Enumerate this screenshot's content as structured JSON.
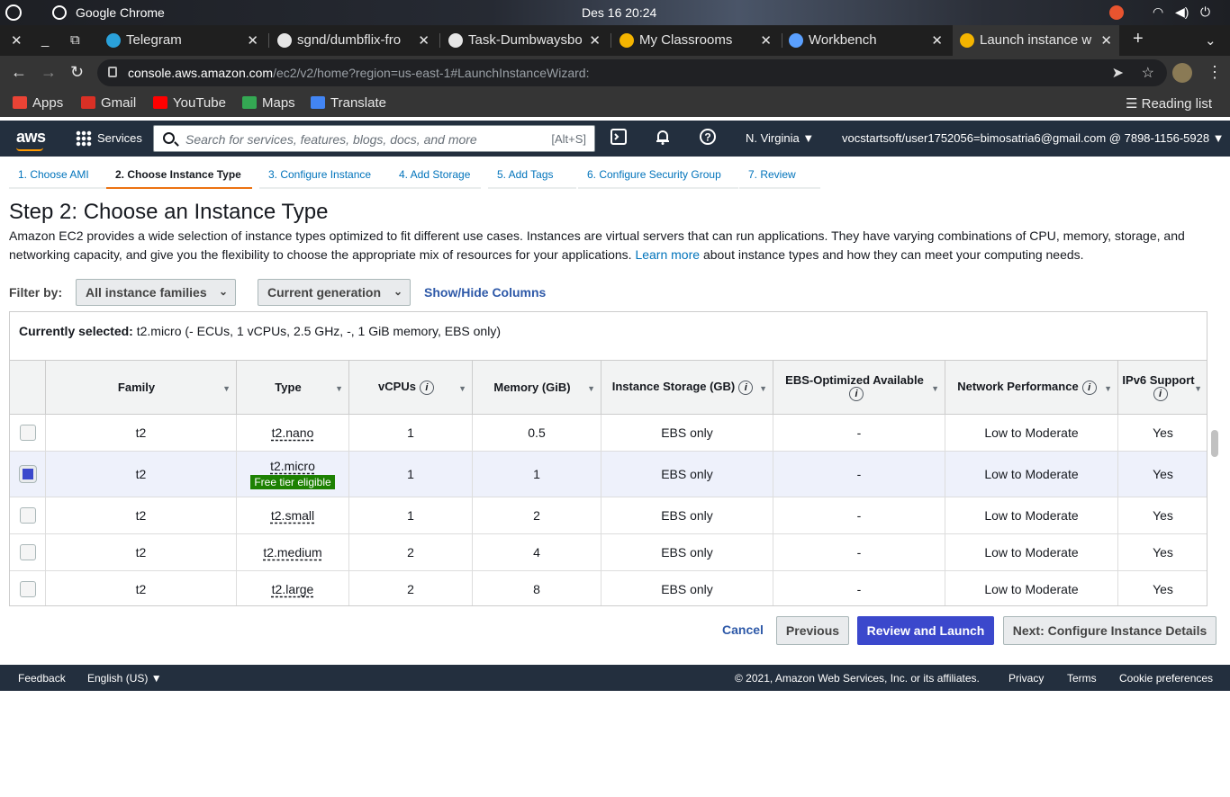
{
  "os": {
    "app_name": "Google Chrome",
    "clock": "Des 16  20:24"
  },
  "browser": {
    "tabs": [
      {
        "label": "Telegram",
        "icon": "telegram-icon",
        "color": "#2aa1da"
      },
      {
        "label": "sgnd/dumbflix-fro",
        "icon": "github-icon",
        "color": "#e6e6e6"
      },
      {
        "label": "Task-Dumbwaysbo",
        "icon": "github-icon",
        "color": "#e6e6e6"
      },
      {
        "label": "My Classrooms",
        "icon": "classroom-icon",
        "color": "#f4b400"
      },
      {
        "label": "Workbench",
        "icon": "workbench-icon",
        "color": "#5aa0ff"
      },
      {
        "label": "Launch instance w",
        "icon": "aws-cube-icon",
        "color": "#f4b400"
      }
    ],
    "url_host": "console.aws.amazon.com",
    "url_rest": "/ec2/v2/home?region=us-east-1#LaunchInstanceWizard:",
    "bookmarks": [
      {
        "label": "Apps",
        "color": "#ea4335"
      },
      {
        "label": "Gmail",
        "color": "#d93025"
      },
      {
        "label": "YouTube",
        "color": "#ff0000"
      },
      {
        "label": "Maps",
        "color": "#34a853"
      },
      {
        "label": "Translate",
        "color": "#4285f4"
      }
    ],
    "reading_list": "Reading list"
  },
  "aws": {
    "logo": "aws",
    "services": "Services",
    "search_placeholder": "Search for services, features, blogs, docs, and more",
    "search_shortcut": "[Alt+S]",
    "region": "N. Virginia ▼",
    "account": "vocstartsoft/user1752056=bimosatria6@gmail.com @ 7898-1156-5928 ▼",
    "accent": "#ff9900"
  },
  "steps": [
    "1. Choose AMI",
    "2. Choose Instance Type",
    "3. Configure Instance",
    "4. Add Storage",
    "5. Add Tags",
    "6. Configure Security Group",
    "7. Review"
  ],
  "page": {
    "title": "Step 2: Choose an Instance Type",
    "desc_1": "Amazon EC2 provides a wide selection of instance types optimized to fit different use cases. Instances are virtual servers that can run applications. They have varying combinations of CPU, memory, storage, and networking capacity, and give you the flexibility to choose the appropriate mix of resources for your applications.",
    "learn_more": "Learn more",
    "desc_2": "about instance types and how they can meet your computing needs.",
    "filter_label": "Filter by:",
    "filter_family": "All instance families",
    "filter_generation": "Current generation",
    "show_hide": "Show/Hide Columns",
    "selected_label": "Currently selected:",
    "selected_value": "t2.micro (- ECUs, 1 vCPUs, 2.5 GHz, -, 1 GiB memory, EBS only)"
  },
  "table": {
    "columns": [
      "Family",
      "Type",
      "vCPUs",
      "Memory (GiB)",
      "Instance Storage (GB)",
      "EBS-Optimized Available",
      "Network Performance",
      "IPv6 Support"
    ],
    "rows": [
      {
        "family": "t2",
        "type": "t2.nano",
        "vcpus": "1",
        "memory": "0.5",
        "storage": "EBS only",
        "ebs": "-",
        "network": "Low to Moderate",
        "ipv6": "Yes",
        "selected": false
      },
      {
        "family": "t2",
        "type": "t2.micro",
        "badge": "Free tier eligible",
        "vcpus": "1",
        "memory": "1",
        "storage": "EBS only",
        "ebs": "-",
        "network": "Low to Moderate",
        "ipv6": "Yes",
        "selected": true
      },
      {
        "family": "t2",
        "type": "t2.small",
        "vcpus": "1",
        "memory": "2",
        "storage": "EBS only",
        "ebs": "-",
        "network": "Low to Moderate",
        "ipv6": "Yes",
        "selected": false
      },
      {
        "family": "t2",
        "type": "t2.medium",
        "vcpus": "2",
        "memory": "4",
        "storage": "EBS only",
        "ebs": "-",
        "network": "Low to Moderate",
        "ipv6": "Yes",
        "selected": false
      },
      {
        "family": "t2",
        "type": "t2.large",
        "vcpus": "2",
        "memory": "8",
        "storage": "EBS only",
        "ebs": "-",
        "network": "Low to Moderate",
        "ipv6": "Yes",
        "selected": false
      }
    ]
  },
  "buttons": {
    "cancel": "Cancel",
    "previous": "Previous",
    "review_launch": "Review and Launch",
    "next": "Next: Configure Instance Details"
  },
  "footer": {
    "feedback": "Feedback",
    "language": "English (US) ▼",
    "copyright": "© 2021, Amazon Web Services, Inc. or its affiliates.",
    "privacy": "Privacy",
    "terms": "Terms",
    "cookies": "Cookie preferences"
  }
}
